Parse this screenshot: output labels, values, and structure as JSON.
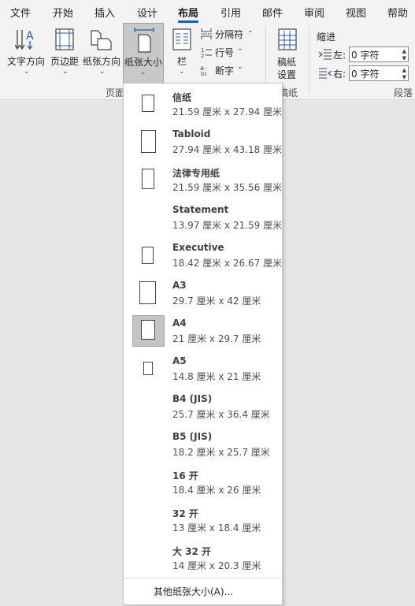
{
  "tabs": [
    "文件",
    "开始",
    "插入",
    "设计",
    "布局",
    "引用",
    "邮件",
    "审阅",
    "视图",
    "帮助"
  ],
  "active_tab": "布局",
  "ribbon": {
    "text_direction": "文字方向",
    "margins": "页边距",
    "orientation": "纸张方向",
    "size": "纸张大小",
    "columns": "栏",
    "breaks": "分隔符",
    "line_numbers": "行号",
    "hyphenation": "断字",
    "manuscript_line1": "稿纸",
    "manuscript_line2": "设置",
    "page_setup_group": "页面",
    "manuscript_group": "稿纸",
    "indent_label": "缩进",
    "indent_left_label": "左:",
    "indent_left_value": "0 字符",
    "indent_right_label": "右:",
    "indent_right_value": "0 字符",
    "paragraph_group": "段落"
  },
  "paper_sizes": [
    {
      "name": "信纸",
      "dims": "21.59 厘米 x 27.94 厘米"
    },
    {
      "name": "Tabloid",
      "dims": "27.94 厘米 x 43.18 厘米"
    },
    {
      "name": "法律专用纸",
      "dims": "21.59 厘米 x 35.56 厘米"
    },
    {
      "name": "Statement",
      "dims": "13.97 厘米 x 21.59 厘米"
    },
    {
      "name": "Executive",
      "dims": "18.42 厘米 x 26.67 厘米"
    },
    {
      "name": "A3",
      "dims": "29.7 厘米 x 42 厘米"
    },
    {
      "name": "A4",
      "dims": "21 厘米 x 29.7 厘米"
    },
    {
      "name": "A5",
      "dims": "14.8 厘米 x 21 厘米"
    },
    {
      "name": "B4 (JIS)",
      "dims": "25.7 厘米 x 36.4 厘米"
    },
    {
      "name": "B5 (JIS)",
      "dims": "18.2 厘米 x 25.7 厘米"
    },
    {
      "name": "16 开",
      "dims": "18.4 厘米 x 26 厘米"
    },
    {
      "name": "32 开",
      "dims": "13 厘米 x 18.4 厘米"
    },
    {
      "name": "大 32 开",
      "dims": "14 厘米 x 20.3 厘米"
    }
  ],
  "selected_size": "A4",
  "more_sizes": "其他纸张大小(A)..."
}
